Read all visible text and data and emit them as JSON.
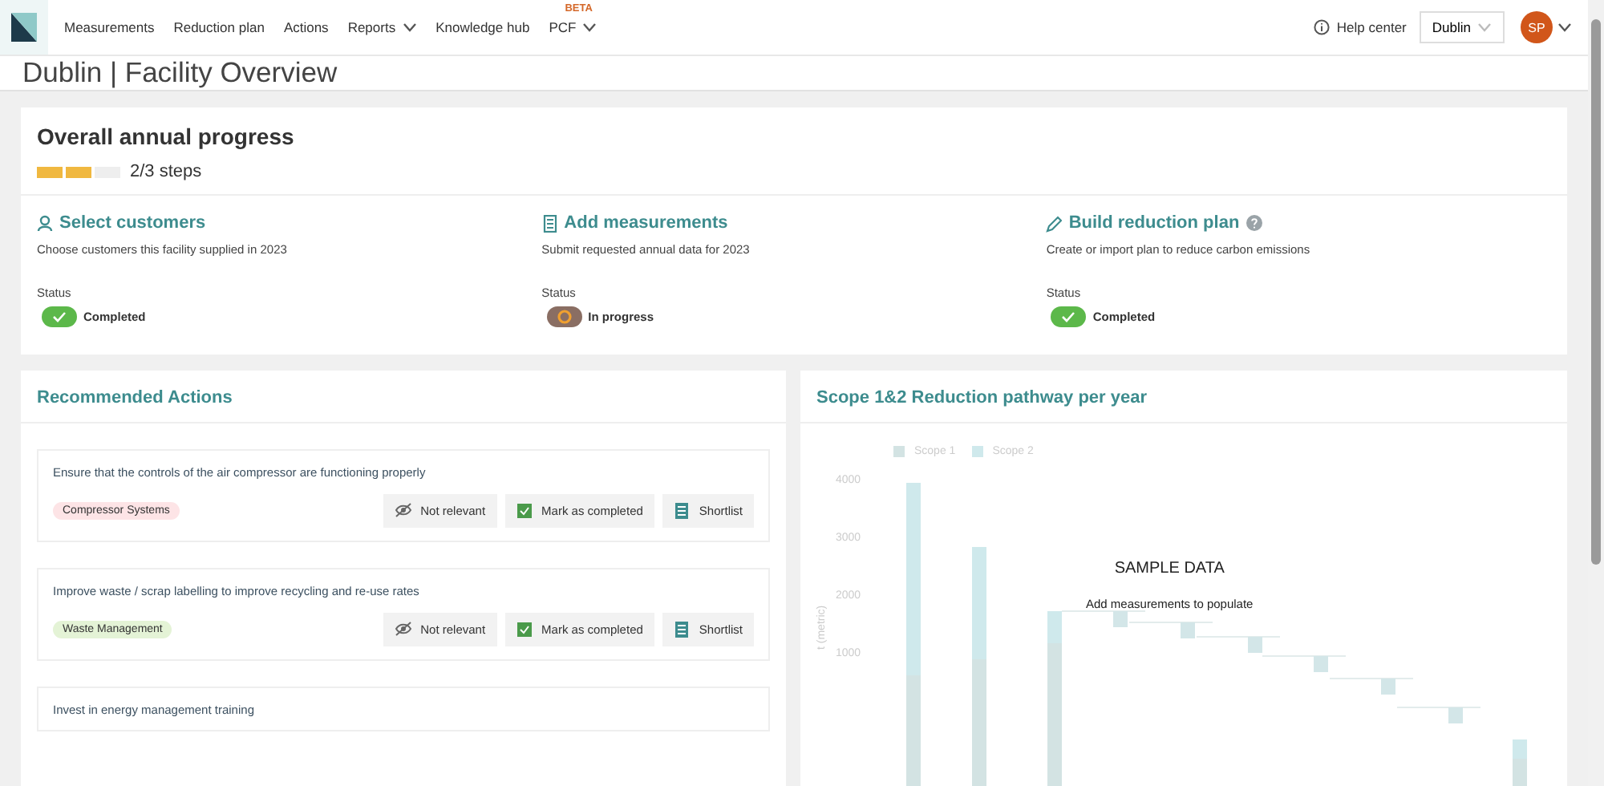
{
  "nav": {
    "items": [
      {
        "label": "Measurements",
        "dropdown": false
      },
      {
        "label": "Reduction plan",
        "dropdown": false
      },
      {
        "label": "Actions",
        "dropdown": false
      },
      {
        "label": "Reports",
        "dropdown": true
      },
      {
        "label": "Knowledge hub",
        "dropdown": false
      },
      {
        "label": "PCF",
        "dropdown": true,
        "badge": "BETA"
      }
    ],
    "help": "Help center",
    "location": "Dublin",
    "avatar": "SP"
  },
  "page_title": "Dublin | Facility Overview",
  "progress": {
    "title": "Overall annual progress",
    "segments": [
      {
        "done": true
      },
      {
        "done": true
      },
      {
        "done": false
      }
    ],
    "label": "2/3 steps"
  },
  "steps": [
    {
      "title": "Select customers",
      "help": false,
      "description": "Choose customers this facility supplied in 2023",
      "status_label": "Status",
      "status": {
        "kind": "completed",
        "label": "Completed"
      }
    },
    {
      "title": "Add measurements",
      "help": false,
      "description": "Submit requested annual data for 2023",
      "status_label": "Status",
      "status": {
        "kind": "in_progress",
        "label": "In progress"
      }
    },
    {
      "title": "Build reduction plan",
      "help": true,
      "description": "Create or import plan to reduce carbon emissions",
      "status_label": "Status",
      "status": {
        "kind": "completed",
        "label": "Completed"
      }
    }
  ],
  "actions": {
    "title": "Recommended Actions",
    "items": [
      {
        "text": "Ensure that the controls of the air compressor are functioning properly",
        "tag": {
          "label": "Compressor Systems",
          "color": "#fde4e6"
        },
        "buttons": [
          "Not relevant",
          "Mark as completed",
          "Shortlist"
        ]
      },
      {
        "text": "Improve waste / scrap labelling to improve recycling and re-use rates",
        "tag": {
          "label": "Waste Management",
          "color": "#e4f3d6"
        },
        "buttons": [
          "Not relevant",
          "Mark as completed",
          "Shortlist"
        ]
      },
      {
        "text": "Invest in energy management training"
      }
    ]
  },
  "pathway": {
    "title": "Scope 1&2 Reduction pathway per year",
    "legend": [
      "Scope 1",
      "Scope 2"
    ],
    "yticks": [
      "4000",
      "3000",
      "2000",
      "1000"
    ],
    "ylabel": "t (metric)",
    "overlay_title": "SAMPLE DATA",
    "overlay_text": "Add measurements to populate"
  }
}
